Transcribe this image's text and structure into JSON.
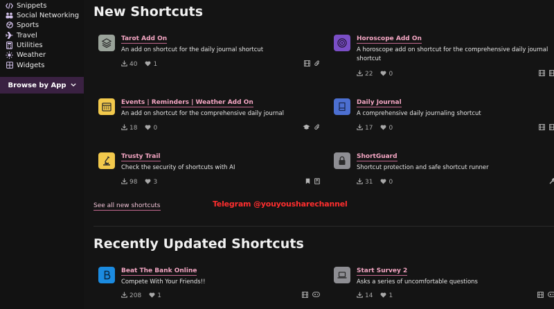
{
  "sidebar": {
    "items": [
      {
        "label": "Snippets",
        "icon": "code-icon"
      },
      {
        "label": "Social Networking",
        "icon": "people-icon"
      },
      {
        "label": "Sports",
        "icon": "ball-icon"
      },
      {
        "label": "Travel",
        "icon": "plane-icon"
      },
      {
        "label": "Utilities",
        "icon": "calculator-icon"
      },
      {
        "label": "Weather",
        "icon": "sun-icon"
      },
      {
        "label": "Widgets",
        "icon": "grid-icon"
      }
    ],
    "browse_label": "Browse by App"
  },
  "new_shortcuts": {
    "title": "New Shortcuts",
    "see_all": "See all new shortcuts",
    "cards": [
      {
        "name": "Tarot Add On",
        "desc": "An add on shortcut for the daily journal shortcut",
        "downloads": "40",
        "likes": "1",
        "icon": "layers-icon",
        "color": "#9aa39a"
      },
      {
        "name": "Horoscope Add On",
        "desc": "A horoscope add on shortcut for the comprehensive daily journal shortcut",
        "downloads": "22",
        "likes": "0",
        "icon": "target-icon",
        "color": "#7a4ec6"
      },
      {
        "name": "Events | Reminders | Weather Add On",
        "desc": "An add on shortcut for the comprehensive daily journal",
        "downloads": "18",
        "likes": "0",
        "icon": "calendar-icon",
        "color": "#f2c94c"
      },
      {
        "name": "Daily Journal",
        "desc": "A comprehensive daily journaling shortcut",
        "downloads": "17",
        "likes": "0",
        "icon": "book-icon",
        "color": "#4c6fd1"
      },
      {
        "name": "Trusty Trail",
        "desc": "Check the security of shortcuts with AI",
        "downloads": "98",
        "likes": "3",
        "icon": "microscope-icon",
        "color": "#f2c94c"
      },
      {
        "name": "ShortGuard",
        "desc": "Shortcut protection and safe shortcut runner",
        "downloads": "31",
        "likes": "0",
        "icon": "lock-icon",
        "color": "#8e8e93"
      }
    ]
  },
  "recent": {
    "title": "Recently Updated Shortcuts",
    "cards": [
      {
        "name": "Beat The Bank Online",
        "desc": "Compete With Your Friends!!",
        "downloads": "208",
        "likes": "1",
        "icon": "b-icon",
        "color": "#1b8be0"
      },
      {
        "name": "Start Survey 2",
        "desc": "Asks a series of uncomfortable questions",
        "downloads": "14",
        "likes": "1",
        "icon": "laptop-icon",
        "color": "#8e8e93"
      }
    ]
  },
  "watermark": "Telegram @youyousharechannel",
  "colors": {
    "accent": "#f4a6c3",
    "sidebar_active": "#3a2142",
    "background": "#141414"
  }
}
